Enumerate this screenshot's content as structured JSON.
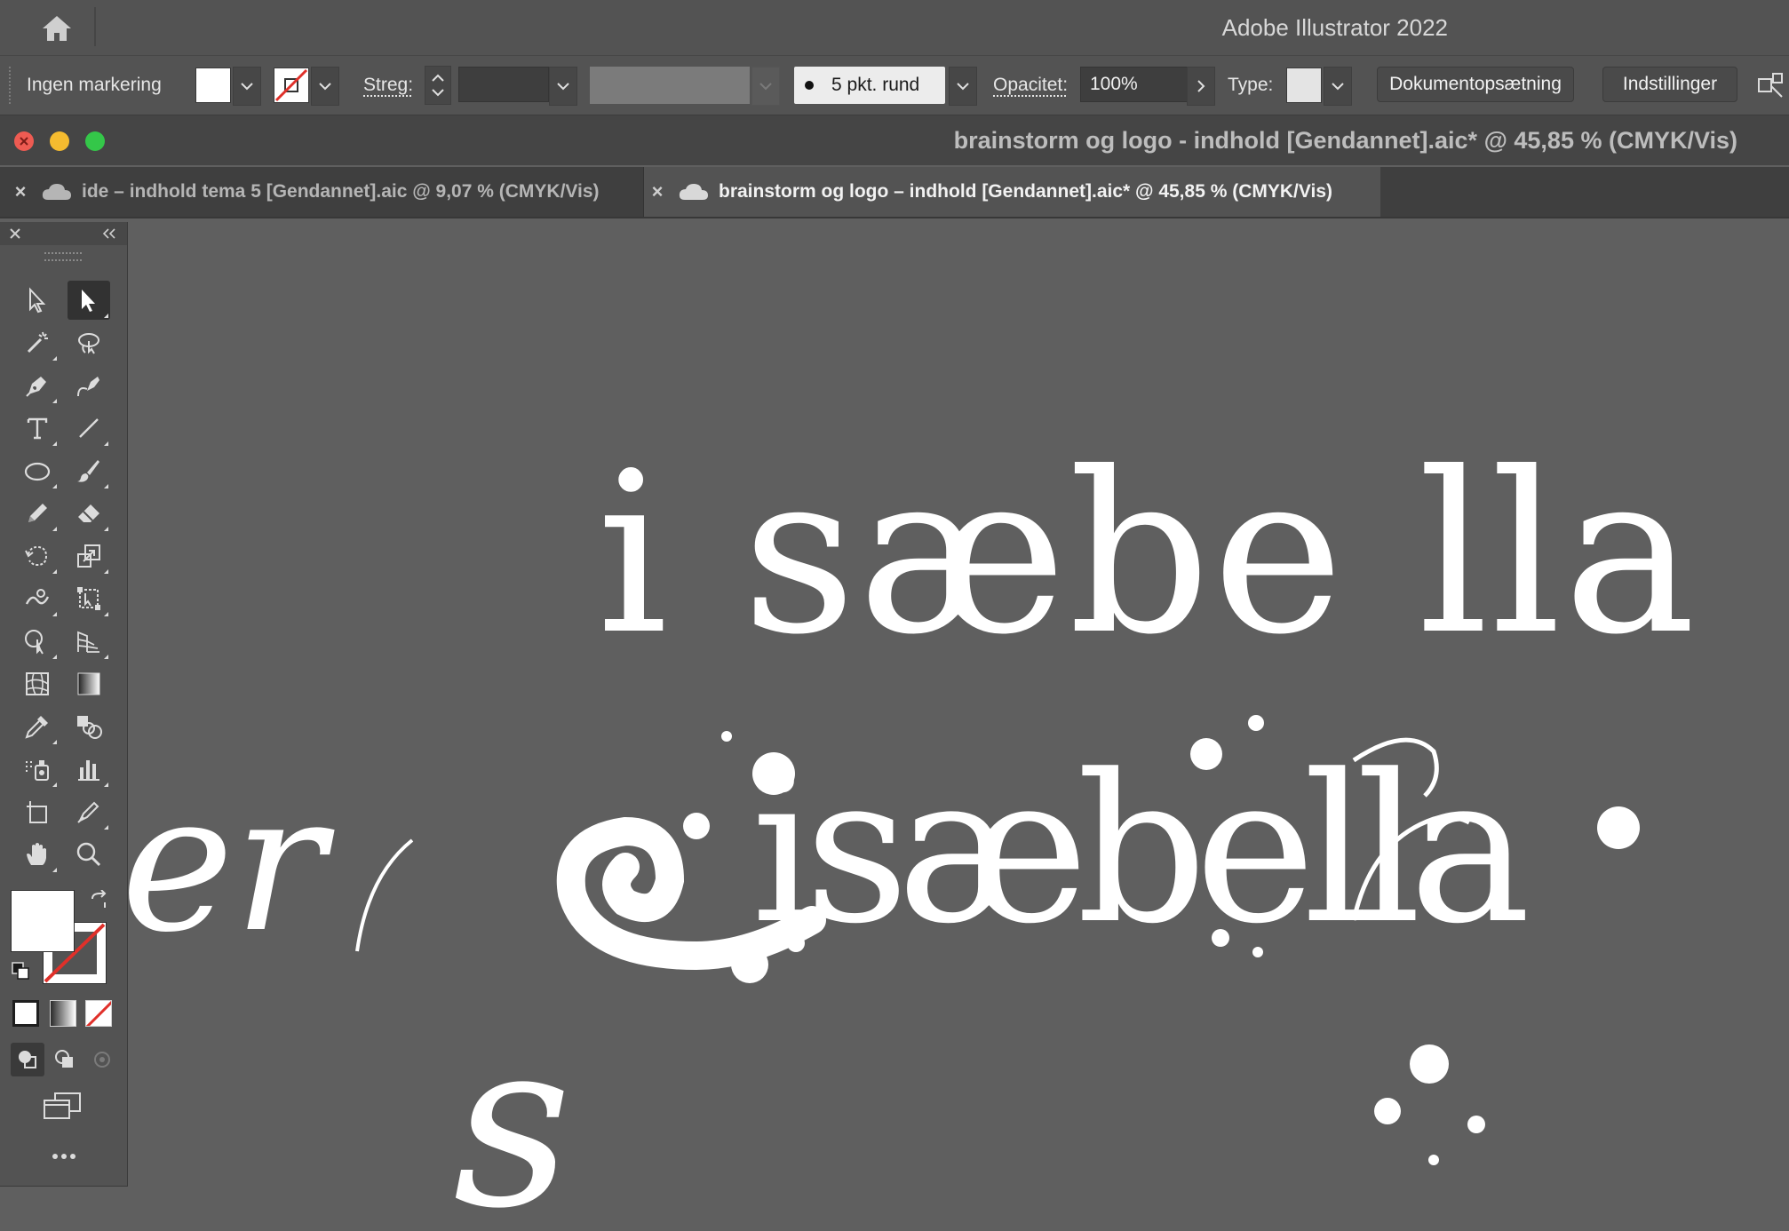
{
  "app": {
    "title": "Adobe Illustrator 2022",
    "home_icon": "home-icon"
  },
  "control_bar": {
    "selection_label": "Ingen markering",
    "stroke_label": "Streg:",
    "stroke_weight_value": "",
    "brush_label": "5 pkt. rund",
    "opacity_label": "Opacitet:",
    "opacity_value": "100%",
    "type_label": "Type:",
    "document_setup_button": "Dokumentopsætning",
    "preferences_button": "Indstillinger"
  },
  "document_window": {
    "title": "brainstorm og logo - indhold [Gendannet].aic* @ 45,85 % (CMYK/Vis)"
  },
  "tabs": [
    {
      "label": "ide – indhold tema 5 [Gendannet].aic @ 9,07 % (CMYK/Vis)",
      "active": false
    },
    {
      "label": "brainstorm og logo – indhold [Gendannet].aic* @ 45,85 % (CMYK/Vis)",
      "active": true
    }
  ],
  "tools": [
    "selection-tool",
    "direct-selection-tool",
    "magic-wand-tool",
    "lasso-tool",
    "pen-tool",
    "curvature-tool",
    "type-tool",
    "line-segment-tool",
    "ellipse-tool",
    "paintbrush-tool",
    "pencil-tool",
    "eraser-tool",
    "rotate-tool",
    "scale-tool",
    "warp-tool",
    "free-transform-tool",
    "shape-builder-tool",
    "perspective-grid-tool",
    "mesh-tool",
    "gradient-tool",
    "eyedropper-tool",
    "blend-tool",
    "symbol-sprayer-tool",
    "column-graph-tool",
    "artboard-tool",
    "slice-tool",
    "hand-tool",
    "zoom-tool"
  ],
  "artwork": {
    "line1": "i sæbe lla",
    "line2": "isæbella",
    "fragment_left": "er",
    "fragment_bottom": "s"
  },
  "colors": {
    "ui_background": "#535353",
    "canvas": "#5f5f5f",
    "artwork": "#ffffff",
    "close": "#ee5b52",
    "minimize": "#f5bb2f",
    "zoom": "#34c749"
  }
}
